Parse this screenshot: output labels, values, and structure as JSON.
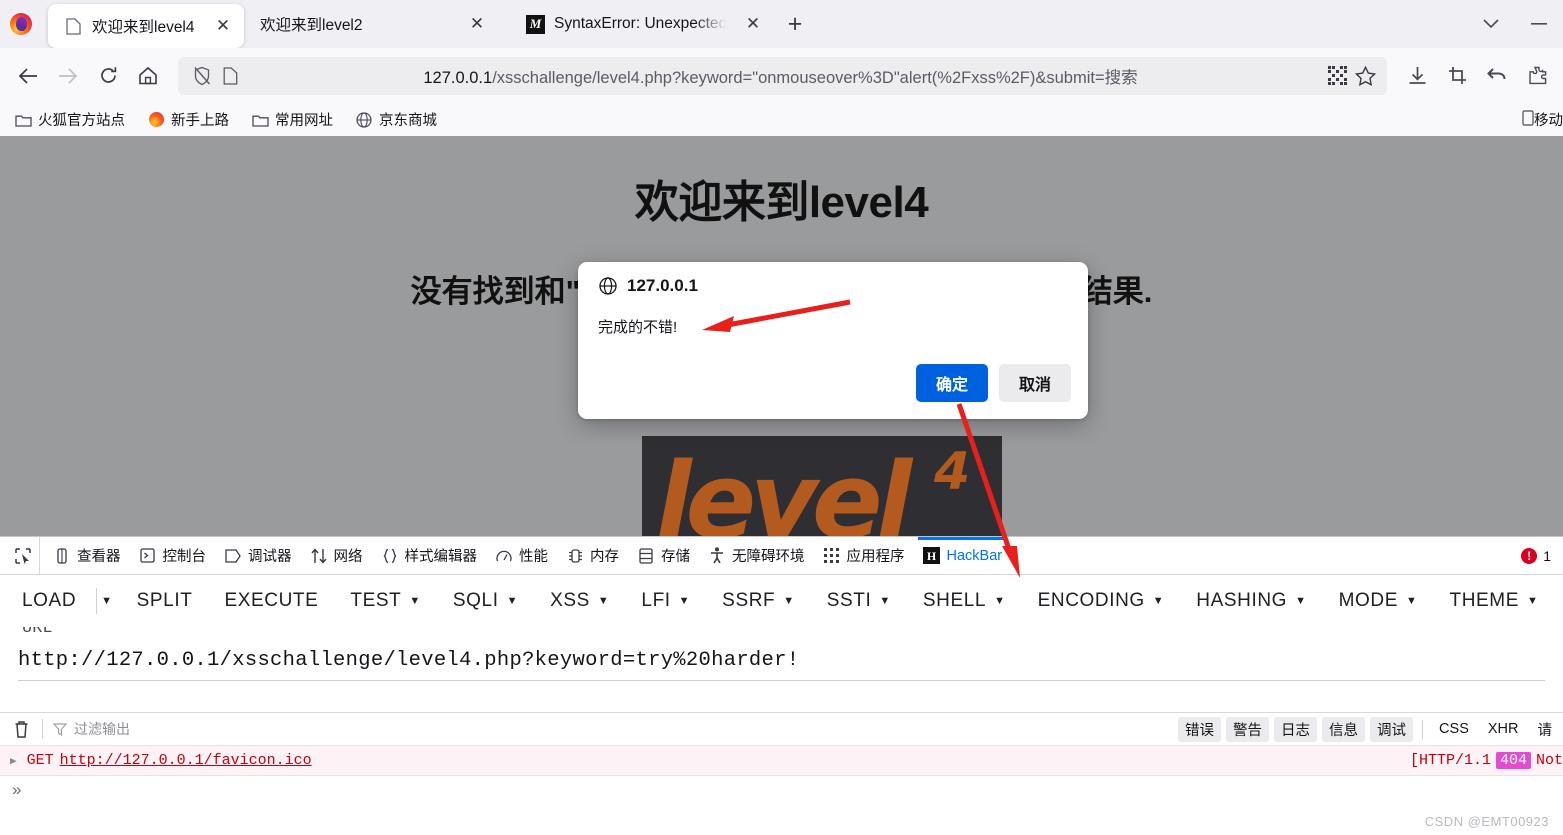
{
  "window": {
    "controls": [
      {
        "name": "list-all-tabs",
        "glyph": "chevron-down"
      },
      {
        "name": "minimize",
        "glyph": "minimize"
      }
    ]
  },
  "tabs": {
    "new_tab_label": "+",
    "close_label": "✕",
    "items": [
      {
        "title": "欢迎来到level4",
        "favicon": "blank-page-icon",
        "active": true
      },
      {
        "title": "欢迎来到level2",
        "favicon": "blank-page-icon",
        "active": false
      },
      {
        "title": "SyntaxError: Unexpected toke",
        "favicon": "mdn-icon",
        "active": false
      }
    ]
  },
  "navbar": {
    "back_label": "←",
    "forward_label": "→",
    "reload_label": "↻",
    "home_label": "home-icon",
    "url_host": "127.0.0.1",
    "url_path": "/xsschallenge/level4.php?keyword=\"onmouseover%3D\"alert(%2Fxss%2F)&submit=搜索",
    "right_icons": [
      "downloads-icon",
      "screenshot-icon",
      "undo-close-tab-icon",
      "extensions-icon"
    ]
  },
  "bookmarks": {
    "items": [
      {
        "label": "火狐官方站点",
        "icon": "folder-icon"
      },
      {
        "label": "新手上路",
        "icon": "firefox-icon"
      },
      {
        "label": "常用网址",
        "icon": "folder-icon"
      },
      {
        "label": "京东商城",
        "icon": "globe-icon"
      }
    ],
    "overflow_label": "移动",
    "overflow_icon": "mobile-icon"
  },
  "page": {
    "heading": "欢迎来到level4",
    "subheading": "没有找到和\" onmouseover=\"alert(/xss/) 相关的结果.",
    "logo_text": "level",
    "logo_sup": "4",
    "bg_color": "#9a9b9d",
    "logo_bg": "#2e2e33",
    "logo_color": "#b35a1f"
  },
  "dialog": {
    "title": "127.0.0.1",
    "title_icon": "globe-icon",
    "message": "完成的不错!",
    "ok_label": "确定",
    "cancel_label": "取消",
    "ok_color": "#0061e0"
  },
  "annotations": {
    "arrow_color": "#e8201c",
    "count": 2
  },
  "devtools": {
    "picker_icon": "element-picker-icon",
    "tabs": [
      {
        "label": "查看器",
        "icon": "inspector-icon",
        "selected": false
      },
      {
        "label": "控制台",
        "icon": "console-icon",
        "selected": false
      },
      {
        "label": "调试器",
        "icon": "debugger-icon",
        "selected": false
      },
      {
        "label": "网络",
        "icon": "network-icon",
        "selected": false
      },
      {
        "label": "样式编辑器",
        "icon": "style-editor-icon",
        "selected": false
      },
      {
        "label": "性能",
        "icon": "performance-icon",
        "selected": false
      },
      {
        "label": "内存",
        "icon": "memory-icon",
        "selected": false
      },
      {
        "label": "存储",
        "icon": "storage-icon",
        "selected": false
      },
      {
        "label": "无障碍环境",
        "icon": "accessibility-icon",
        "selected": false
      },
      {
        "label": "应用程序",
        "icon": "application-icon",
        "selected": false
      },
      {
        "label": "HackBar",
        "icon": "hackbar-icon",
        "selected": true
      }
    ],
    "error_count": "1"
  },
  "hackbar": {
    "menu": [
      {
        "label": "LOAD",
        "caret": false
      },
      {
        "label": "",
        "caret": true,
        "caret_only": true
      },
      {
        "label": "SPLIT",
        "caret": false
      },
      {
        "label": "EXECUTE",
        "caret": false
      },
      {
        "label": "TEST",
        "caret": true
      },
      {
        "label": "SQLI",
        "caret": true
      },
      {
        "label": "XSS",
        "caret": true
      },
      {
        "label": "LFI",
        "caret": true
      },
      {
        "label": "SSRF",
        "caret": true
      },
      {
        "label": "SSTI",
        "caret": true
      },
      {
        "label": "SHELL",
        "caret": true
      },
      {
        "label": "ENCODING",
        "caret": true
      },
      {
        "label": "HASHING",
        "caret": true
      },
      {
        "label": "MODE",
        "caret": true
      },
      {
        "label": "THEME",
        "caret": true
      }
    ],
    "field_label": "URL",
    "url_value": "http://127.0.0.1/xsschallenge/level4.php?keyword=try%20harder!"
  },
  "console": {
    "trash_icon": "trash-icon",
    "filter_icon": "filter-icon",
    "filter_placeholder": "过滤输出",
    "filter_pills": [
      {
        "label": "错误",
        "active": true
      },
      {
        "label": "警告",
        "active": true
      },
      {
        "label": "日志",
        "active": true
      },
      {
        "label": "信息",
        "active": true
      },
      {
        "label": "调试",
        "active": true
      },
      {
        "label": "CSS",
        "active": false
      },
      {
        "label": "XHR",
        "active": false
      },
      {
        "label": "请",
        "active": false
      }
    ],
    "rows": [
      {
        "twisty": "▶",
        "method": "GET",
        "url": "http://127.0.0.1/favicon.ico",
        "status_prefix": "[HTTP/1.1",
        "status_code": "404",
        "status_suffix": "Not"
      }
    ],
    "prompt": "»"
  },
  "watermark": "CSDN @EMT00923"
}
